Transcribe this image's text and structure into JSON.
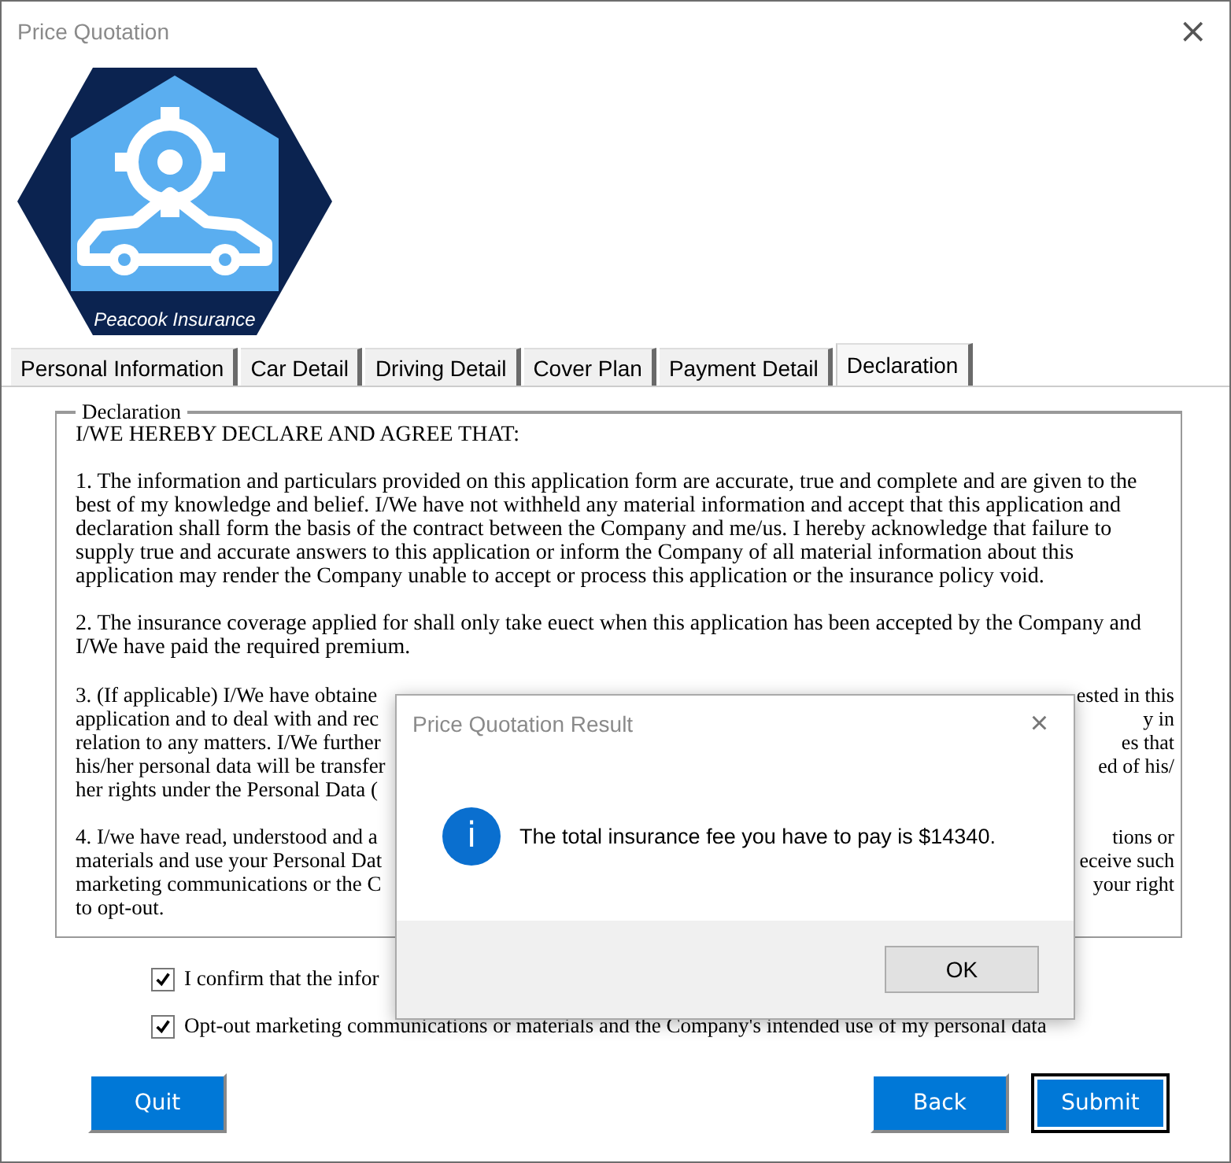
{
  "window": {
    "title": "Price Quotation",
    "close": "×"
  },
  "logo": {
    "text": "Peacook Insurance"
  },
  "tabs": [
    {
      "label": "Personal Information",
      "selected": false
    },
    {
      "label": "Car Detail",
      "selected": false
    },
    {
      "label": "Driving Detail",
      "selected": false
    },
    {
      "label": "Cover Plan",
      "selected": false
    },
    {
      "label": "Payment Detail",
      "selected": false
    },
    {
      "label": "Declaration",
      "selected": true
    }
  ],
  "declaration": {
    "legend": "Declaration",
    "heading": "I/WE HEREBY DECLARE AND AGREE THAT:",
    "paragraphs": [
      "1. The information and particulars provided on this application form are accurate, true and complete and are given to the best of my knowledge and belief. I/We have not withheld any material information and accept that this application and declaration shall form the basis of the contract between the Company and me/us. I hereby acknowledge that failure to supply true and accurate answers to this application or inform the Company of all material information about this application may render the Company unable to accept or process this application or the insurance policy void.",
      "2. The insurance coverage applied for shall only take euect when this application has been accepted by the Company and I/We have paid the required premium."
    ],
    "partial_paragraphs": [
      [
        {
          "left": "3. (If applicable) I/We have obtaine",
          "right": "ested in this"
        },
        {
          "left": "application and to deal with and rec",
          "right": "y in"
        },
        {
          "left": "relation to any matters. I/We further",
          "right": "es that"
        },
        {
          "left": "his/her personal data will be transfer",
          "right": "ed of his/"
        },
        {
          "left": "her rights under the Personal Data ("
        }
      ],
      [
        {
          "left": "4. I/we have read, understood and a",
          "right": "tions or"
        },
        {
          "left": "materials and use your Personal Dat",
          "right": "eceive such"
        },
        {
          "left": "marketing communications or the C",
          "right": "your right"
        },
        {
          "left": "to opt-out."
        }
      ]
    ]
  },
  "checkboxes": [
    {
      "label": "I confirm that the infor",
      "checked": true
    },
    {
      "label": "Opt-out marketing communications or materials and the Company's intended use of  my personal data",
      "checked": true
    }
  ],
  "buttons": [
    {
      "label": "Quit",
      "focused": false
    },
    {
      "label": "Back",
      "focused": false
    },
    {
      "label": "Submit",
      "focused": true
    }
  ],
  "dialog": {
    "title": "Price Quotation Result",
    "close": "×",
    "icon": "i",
    "message": "The total insurance fee you have to pay is $14340.",
    "button": "OK"
  }
}
